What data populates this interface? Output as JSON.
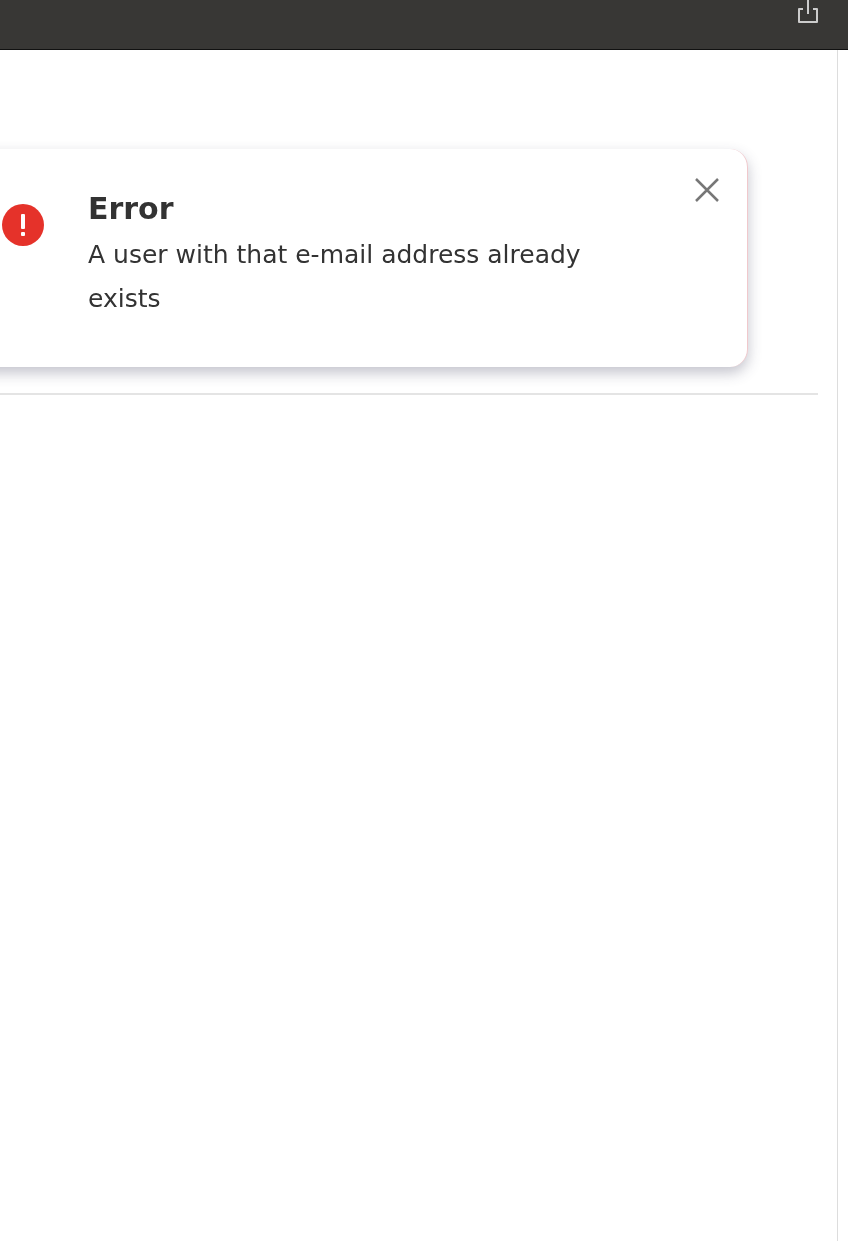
{
  "toast": {
    "title": "Error",
    "message": "A user with that e-mail address already exists"
  }
}
